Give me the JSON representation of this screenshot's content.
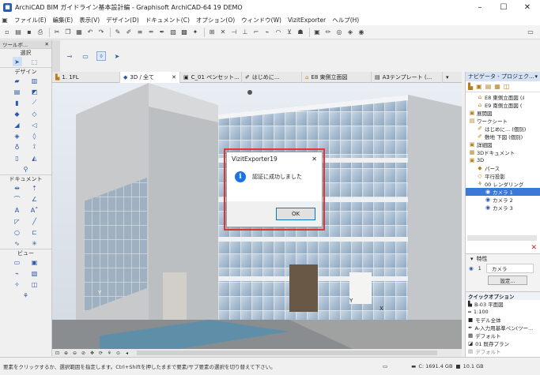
{
  "window": {
    "title": "ArchiCAD BIM ガイドライン基本設計編 - Graphisoft ArchiCAD-64 19 DEMO",
    "minimize": "–",
    "maximize": "☐",
    "close": "✕"
  },
  "menu": [
    "ファイル(E)",
    "編集(E)",
    "表示(V)",
    "デザイン(D)",
    "ドキュメント(C)",
    "オプション(O)",
    "ウィンドウ(W)",
    "VizitExporter",
    "ヘルプ(H)"
  ],
  "toolbox": {
    "title": "ツールボ...",
    "select_label": "選択",
    "design_label": "デザイン",
    "document_label": "ドキュメント",
    "view_label": "ビュー"
  },
  "tabs": [
    {
      "label": "1. 1FL"
    },
    {
      "label": "3D / 全て"
    },
    {
      "label": "C_01 ペンセット..."
    },
    {
      "label": "はじめに..."
    },
    {
      "label": "E8 東側立面図"
    },
    {
      "label": "A3テンプレート (..."
    }
  ],
  "navigator": {
    "title": "ナビゲータ - プロジェク...",
    "items": [
      {
        "label": "E8 東側立面図 (ﾒ"
      },
      {
        "label": "E9 南側立面図 ("
      },
      {
        "label": "展開図"
      },
      {
        "label": "ワークシート"
      },
      {
        "label": "はじめに... (個別)"
      },
      {
        "label": "敷地 下図 (個別)"
      },
      {
        "label": "詳細図"
      },
      {
        "label": "3Dドキュメント"
      },
      {
        "label": "3D"
      },
      {
        "label": "パース"
      },
      {
        "label": "平行投影"
      },
      {
        "label": "00 レンダリング"
      },
      {
        "label": "カメラ 1"
      },
      {
        "label": "カメラ 2"
      },
      {
        "label": "カメラ 3"
      }
    ]
  },
  "properties": {
    "title": "特性",
    "id": "1",
    "name": "カメラ",
    "settings_button": "設定..."
  },
  "quick_options": {
    "title": "クイックオプション",
    "items": [
      "B-03 平面図",
      "1:100",
      "モデル全体",
      "A-入力用基準ペン(ツー...",
      "デフォルト",
      "01 既存プラン",
      "デフォルト"
    ]
  },
  "status": {
    "hint": "要素をクリックするか、選択範囲を指定します。Ctrl+Shiftを押したままで要素/サブ要素の選択を切り替えて下さい。",
    "disk": "C: 1691.4 GB",
    "memory": "10.1 GB"
  },
  "dialog": {
    "title": "VizitExporter19",
    "message": "認証に成功しました",
    "ok_label": "OK",
    "close": "✕",
    "highlight_color": "#e53935"
  },
  "viewport": {
    "axis_labels": [
      "Y",
      "Y",
      "X"
    ]
  }
}
